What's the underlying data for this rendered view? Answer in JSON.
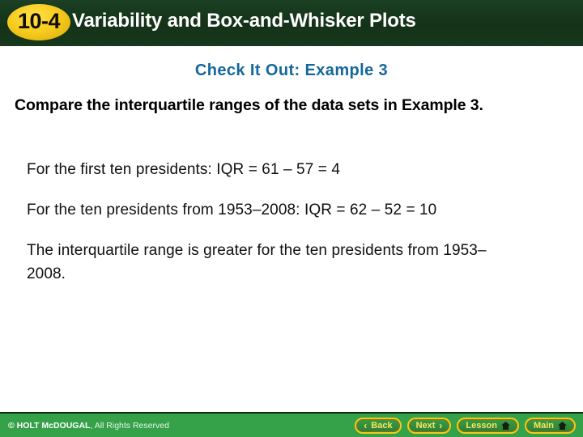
{
  "header": {
    "lesson_number": "10-4",
    "title": "Variability and Box-and-Whisker Plots",
    "bg_color": "#143218",
    "badge_color": "#f6cb1d"
  },
  "body": {
    "example_label": "Check It Out: Example 3",
    "example_label_color": "#15679c",
    "prompt": "Compare the interquartile ranges of the data sets in Example 3.",
    "answers": [
      "For the first ten presidents: IQR = 61 – 57 = 4",
      "For the ten presidents from 1953–2008: IQR = 62 – 52 = 10",
      "The interquartile range is greater for the ten presidents from 1953–2008."
    ]
  },
  "footer": {
    "bg_color": "#35a24a",
    "copyright_symbol": "© HOLT McDOUGAL",
    "copyright_rest": ", All Rights Reserved",
    "buttons": [
      {
        "label": "Back",
        "icon": "chevron-left-icon",
        "glyph": "‹"
      },
      {
        "label": "Next",
        "icon": "chevron-right-icon",
        "glyph": "›"
      },
      {
        "label": "Lesson",
        "icon": "home-icon",
        "glyph": ""
      },
      {
        "label": "Main",
        "icon": "home-icon",
        "glyph": ""
      }
    ]
  }
}
